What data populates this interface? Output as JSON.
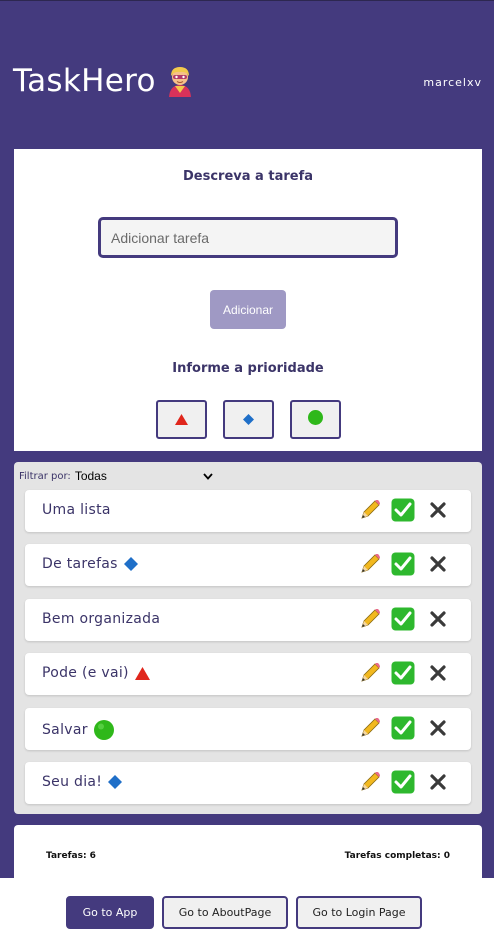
{
  "header": {
    "brand": "TaskHero",
    "brand_icon": "superhero-icon",
    "username": "marcelxv"
  },
  "add_form": {
    "title": "Descreva a tarefa",
    "input_placeholder": "Adicionar tarefa",
    "input_value": "",
    "add_label": "Adicionar",
    "priority_title": "Informe a prioridade",
    "priorities": [
      {
        "name": "high",
        "icon": "red-triangle-icon",
        "color": "#e0261c"
      },
      {
        "name": "medium",
        "icon": "blue-diamond-icon",
        "color": "#1f6fc8"
      },
      {
        "name": "low",
        "icon": "green-circle-icon",
        "color": "#2fb81a"
      }
    ]
  },
  "filter": {
    "label": "Filtrar por:",
    "selected": "Todas"
  },
  "tasks": [
    {
      "text": "Uma lista",
      "priority": ""
    },
    {
      "text": "De tarefas",
      "priority": "medium"
    },
    {
      "text": "Bem organizada",
      "priority": ""
    },
    {
      "text": "Pode (e vai)",
      "priority": "high"
    },
    {
      "text": "Salvar",
      "priority": "low"
    },
    {
      "text": "Seu dia!",
      "priority": "medium"
    }
  ],
  "stats": {
    "total_label": "Tarefas: 6",
    "completed_label": "Tarefas completas: 0"
  },
  "nav": {
    "app": "Go to App",
    "about": "Go to AboutPage",
    "login": "Go to Login Page"
  },
  "colors": {
    "primary": "#443a7e",
    "panel": "#e4e4e4"
  }
}
